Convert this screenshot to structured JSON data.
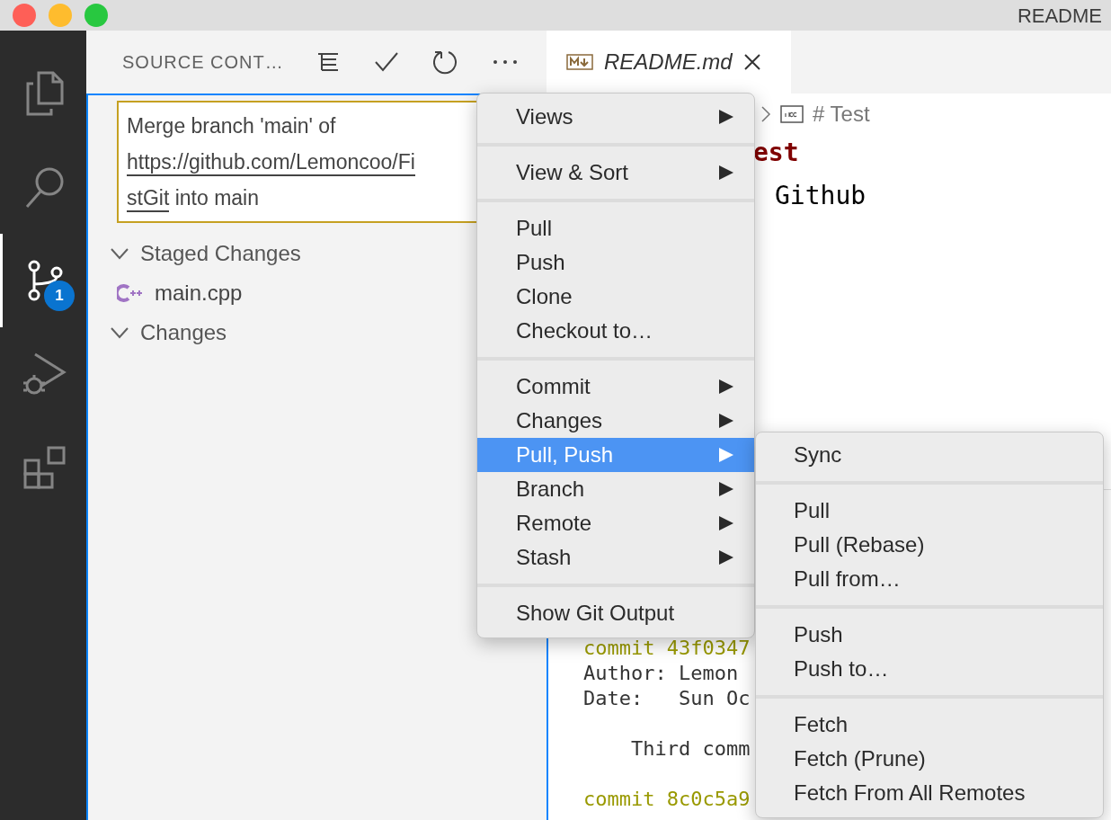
{
  "window": {
    "title": "README"
  },
  "activity_bar": [
    {
      "kind": "files",
      "selected": false
    },
    {
      "kind": "search",
      "selected": false
    },
    {
      "kind": "source-control",
      "selected": true,
      "badge": "1"
    },
    {
      "kind": "run-debug",
      "selected": false
    },
    {
      "kind": "extensions",
      "selected": false
    }
  ],
  "sidebar": {
    "title": "SOURCE CONT…",
    "actions": [
      {
        "kind": "tree"
      },
      {
        "kind": "commit"
      },
      {
        "kind": "refresh"
      },
      {
        "kind": "more"
      }
    ],
    "commit_message": [
      [
        {
          "text": "Merge branch 'main' of",
          "link": false
        }
      ],
      [
        {
          "text": "https://github.com/Lemoncoo/Fi",
          "link": true
        }
      ],
      [
        {
          "text": "stGit",
          "link": true
        },
        {
          "text": " into main",
          "link": false
        }
      ]
    ],
    "groups": [
      {
        "label": "Staged Changes",
        "expanded": true,
        "files": [
          {
            "name": "main.cpp"
          }
        ]
      },
      {
        "label": "Changes",
        "expanded": true
      }
    ]
  },
  "editor": {
    "tabs": [
      {
        "label": "README.md",
        "selected": true
      }
    ],
    "breadcrumb": "# Test",
    "lines": [
      {
        "kind": "heading",
        "text": "est"
      },
      {
        "kind": "text",
        "text": "Github"
      }
    ]
  },
  "terminal": [
    {
      "kind": "commit",
      "text": "commit 43f0347"
    },
    {
      "kind": "plain",
      "text": "Author: Lemon"
    },
    {
      "kind": "plain",
      "text": "Date:   Sun Oc"
    },
    {
      "kind": "message",
      "text": "    Third comm"
    },
    {
      "kind": "commit",
      "text": "commit 8c0c5a9"
    }
  ],
  "context_menu": [
    [
      {
        "label": "Views",
        "submenu": true,
        "selected": false
      }
    ],
    [
      {
        "label": "View & Sort",
        "submenu": true,
        "selected": false
      }
    ],
    [
      {
        "label": "Pull",
        "submenu": false,
        "selected": false
      },
      {
        "label": "Push",
        "submenu": false,
        "selected": false
      },
      {
        "label": "Clone",
        "submenu": false,
        "selected": false
      },
      {
        "label": "Checkout to…",
        "submenu": false,
        "selected": false
      }
    ],
    [
      {
        "label": "Commit",
        "submenu": true,
        "selected": false
      },
      {
        "label": "Changes",
        "submenu": true,
        "selected": false
      },
      {
        "label": "Pull, Push",
        "submenu": true,
        "selected": true
      },
      {
        "label": "Branch",
        "submenu": true,
        "selected": false
      },
      {
        "label": "Remote",
        "submenu": true,
        "selected": false
      },
      {
        "label": "Stash",
        "submenu": true,
        "selected": false
      }
    ],
    [
      {
        "label": "Show Git Output",
        "submenu": false,
        "selected": false
      }
    ]
  ],
  "submenu": [
    [
      {
        "label": "Sync",
        "selected": false
      }
    ],
    [
      {
        "label": "Pull",
        "selected": false
      },
      {
        "label": "Pull (Rebase)",
        "selected": false
      },
      {
        "label": "Pull from…",
        "selected": false
      }
    ],
    [
      {
        "label": "Push",
        "selected": false
      },
      {
        "label": "Push to…",
        "selected": false
      }
    ],
    [
      {
        "label": "Fetch",
        "selected": false
      },
      {
        "label": "Fetch (Prune)",
        "selected": false
      },
      {
        "label": "Fetch From All Remotes",
        "selected": false
      }
    ]
  ]
}
